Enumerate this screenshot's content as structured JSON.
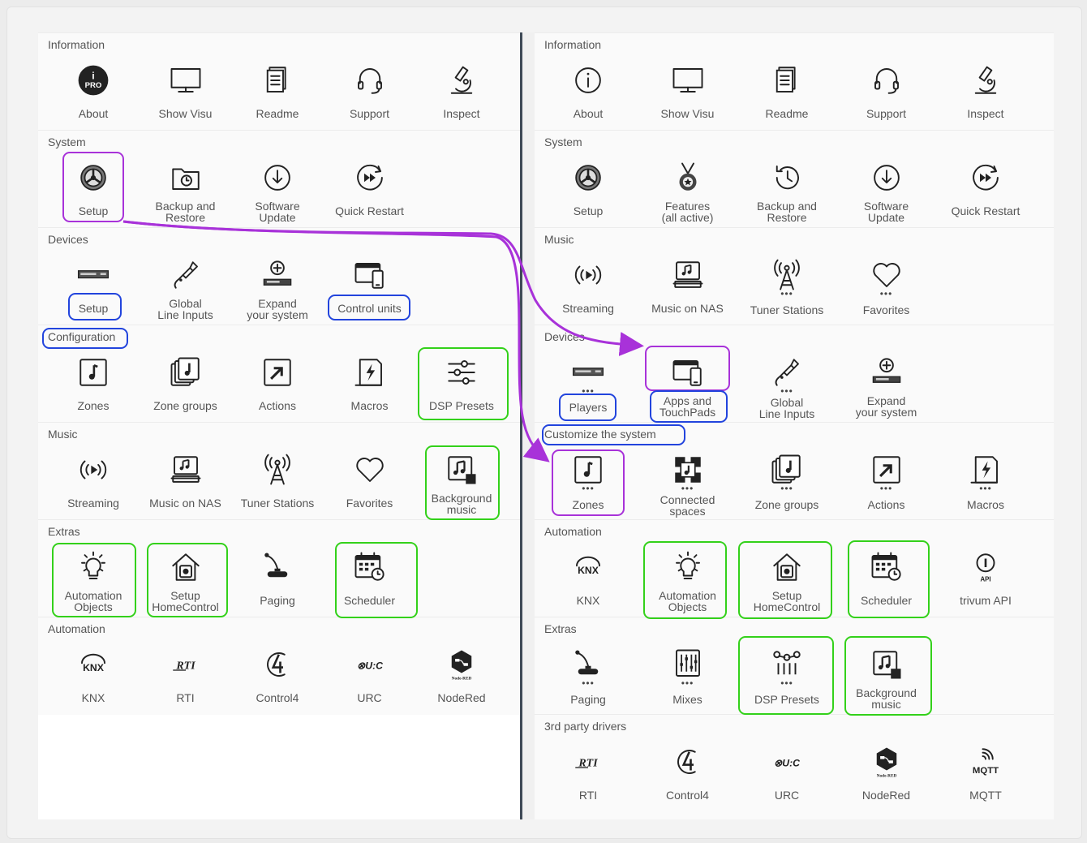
{
  "left": {
    "sections": [
      {
        "title": "Information",
        "items": [
          {
            "label": "About",
            "icon": "about-pro-icon"
          },
          {
            "label": "Show Visu",
            "icon": "monitor-icon"
          },
          {
            "label": "Readme",
            "icon": "document-icon"
          },
          {
            "label": "Support",
            "icon": "headset-icon"
          },
          {
            "label": "Inspect",
            "icon": "microscope-icon"
          }
        ]
      },
      {
        "title": "System",
        "items": [
          {
            "label": "Setup",
            "icon": "gear-icon"
          },
          {
            "label": "Backup and Restore",
            "icon": "folder-restore-icon"
          },
          {
            "label": "Software Update",
            "icon": "download-circle-icon"
          },
          {
            "label": "Quick Restart",
            "icon": "fast-forward-circle-icon"
          }
        ]
      },
      {
        "title": "Devices",
        "items": [
          {
            "label": "Setup",
            "icon": "device-box-icon"
          },
          {
            "label": "Global Line Inputs",
            "icon": "audio-jack-icon"
          },
          {
            "label": "Expand your system",
            "icon": "add-device-icon"
          },
          {
            "label": "Control units",
            "icon": "tablet-phone-icon"
          }
        ]
      },
      {
        "title": "Configuration",
        "items": [
          {
            "label": "Zones",
            "icon": "music-note-icon"
          },
          {
            "label": "Zone groups",
            "icon": "stacked-notes-icon"
          },
          {
            "label": "Actions",
            "icon": "action-arrow-icon"
          },
          {
            "label": "Macros",
            "icon": "macro-page-icon"
          },
          {
            "label": "DSP Presets",
            "icon": "sliders-icon"
          }
        ]
      },
      {
        "title": "Music",
        "items": [
          {
            "label": "Streaming",
            "icon": "streaming-icon"
          },
          {
            "label": "Music on NAS",
            "icon": "nas-music-icon"
          },
          {
            "label": "Tuner Stations",
            "icon": "antenna-icon"
          },
          {
            "label": "Favorites",
            "icon": "heart-icon"
          },
          {
            "label": "Background music",
            "icon": "background-music-icon"
          }
        ]
      },
      {
        "title": "Extras",
        "items": [
          {
            "label": "Automation Objects",
            "icon": "lightbulb-icon"
          },
          {
            "label": "Setup HomeControl",
            "icon": "home-gear-icon"
          },
          {
            "label": "Paging",
            "icon": "microphone-icon"
          },
          {
            "label": "Scheduler",
            "icon": "calendar-clock-icon"
          }
        ]
      },
      {
        "title": "Automation",
        "items": [
          {
            "label": "KNX",
            "icon": "knx-logo-icon"
          },
          {
            "label": "RTI",
            "icon": "rti-logo-icon"
          },
          {
            "label": "Control4",
            "icon": "control4-logo-icon"
          },
          {
            "label": "URC",
            "icon": "urc-logo-icon"
          },
          {
            "label": "NodeRed",
            "icon": "nodered-logo-icon"
          }
        ]
      }
    ]
  },
  "right": {
    "sections": [
      {
        "title": "Information",
        "items": [
          {
            "label": "About",
            "icon": "info-circle-icon"
          },
          {
            "label": "Show Visu",
            "icon": "monitor-icon"
          },
          {
            "label": "Readme",
            "icon": "document-icon"
          },
          {
            "label": "Support",
            "icon": "headset-icon"
          },
          {
            "label": "Inspect",
            "icon": "microscope-icon"
          }
        ]
      },
      {
        "title": "System",
        "items": [
          {
            "label": "Setup",
            "icon": "gear-icon"
          },
          {
            "label": "Features (all active)",
            "icon": "medal-icon"
          },
          {
            "label": "Backup and Restore",
            "icon": "history-icon"
          },
          {
            "label": "Software Update",
            "icon": "download-circle-icon"
          },
          {
            "label": "Quick Restart",
            "icon": "fast-forward-circle-icon"
          }
        ]
      },
      {
        "title": "Music",
        "items": [
          {
            "label": "Streaming",
            "icon": "streaming-icon"
          },
          {
            "label": "Music on NAS",
            "icon": "nas-music-icon"
          },
          {
            "label": "Tuner Stations",
            "icon": "antenna-icon"
          },
          {
            "label": "Favorites",
            "icon": "heart-icon"
          }
        ]
      },
      {
        "title": "Devices",
        "items": [
          {
            "label": "Players",
            "icon": "device-box-icon"
          },
          {
            "label": "Apps and TouchPads",
            "icon": "tablet-phone-icon"
          },
          {
            "label": "Global Line Inputs",
            "icon": "audio-jack-icon"
          },
          {
            "label": "Expand your system",
            "icon": "add-device-icon"
          }
        ]
      },
      {
        "title": "Customize the system",
        "items": [
          {
            "label": "Zones",
            "icon": "music-note-icon"
          },
          {
            "label": "Connected spaces",
            "icon": "connected-spaces-icon"
          },
          {
            "label": "Zone groups",
            "icon": "stacked-notes-icon"
          },
          {
            "label": "Actions",
            "icon": "action-arrow-icon"
          },
          {
            "label": "Macros",
            "icon": "macro-page-icon"
          }
        ]
      },
      {
        "title": "Automation",
        "items": [
          {
            "label": "KNX",
            "icon": "knx-logo-icon"
          },
          {
            "label": "Automation Objects",
            "icon": "lightbulb-icon"
          },
          {
            "label": "Setup HomeControl",
            "icon": "home-gear-icon"
          },
          {
            "label": "Scheduler",
            "icon": "calendar-clock-icon"
          },
          {
            "label": "trivum API",
            "icon": "api-icon"
          }
        ]
      },
      {
        "title": "Extras",
        "items": [
          {
            "label": "Paging",
            "icon": "microphone-icon"
          },
          {
            "label": "Mixes",
            "icon": "mixer-icon"
          },
          {
            "label": "DSP Presets",
            "icon": "dsp-nodes-icon"
          },
          {
            "label": "Background music",
            "icon": "background-music-icon"
          }
        ]
      },
      {
        "title": "3rd party drivers",
        "items": [
          {
            "label": "RTI",
            "icon": "rti-logo-icon"
          },
          {
            "label": "Control4",
            "icon": "control4-logo-icon"
          },
          {
            "label": "URC",
            "icon": "urc-logo-icon"
          },
          {
            "label": "NodeRed",
            "icon": "nodered-logo-icon"
          },
          {
            "label": "MQTT",
            "icon": "mqtt-logo-icon"
          }
        ]
      }
    ]
  },
  "colors": {
    "highlight_purple": "#a832d9",
    "highlight_blue": "#2244dd",
    "highlight_green": "#33d11a"
  }
}
